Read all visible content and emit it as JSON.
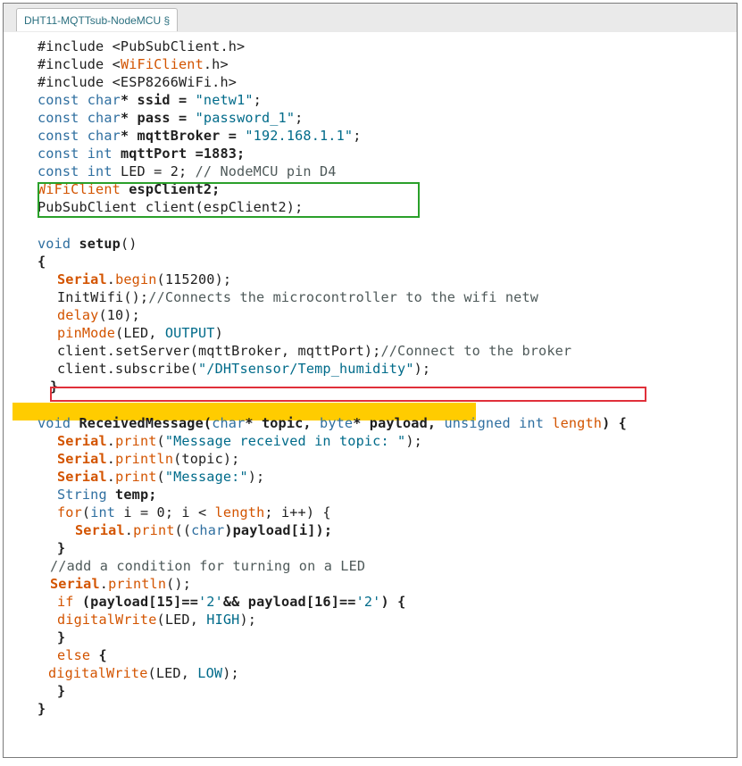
{
  "tab": {
    "label": "DHT11-MQTTsub-NodeMCU §"
  },
  "code": {
    "l1": [
      "#include <PubSubClient.h>"
    ],
    "l2": [
      "#include <",
      "WiFiClient",
      ".h>"
    ],
    "l3": [
      "#include <ESP8266WiFi.h>"
    ],
    "l4": [
      "const",
      " ",
      "char",
      "* ssid = ",
      "\"netw1\"",
      ";"
    ],
    "l5": [
      "const",
      " ",
      "char",
      "* pass = ",
      "\"password_1\"",
      ";"
    ],
    "l6": [
      "const",
      " ",
      "char",
      "* mqttBroker = ",
      "\"192.168.1.1\"",
      ";"
    ],
    "l7": [
      "const",
      " ",
      "int",
      " mqttPort =1883;"
    ],
    "l8": [
      "const",
      " ",
      "int",
      " LED = 2; ",
      "// NodeMCU pin D4"
    ],
    "l9": [
      "WiFiClient",
      " espClient2;"
    ],
    "l10": [
      "PubSubClient client(espClient2);"
    ],
    "l12": [
      "void",
      " ",
      "setup",
      "()"
    ],
    "l13": [
      "{"
    ],
    "l14": [
      "Serial",
      ".",
      "begin",
      "(115200);"
    ],
    "l15": [
      "InitWifi();",
      "//Connects the microcontroller to the wifi netw"
    ],
    "l16": [
      "delay",
      "(10);"
    ],
    "l17": [
      "pinMode",
      "(LED, ",
      "OUTPUT",
      ")"
    ],
    "l18": [
      "client.setServer(mqttBroker, mqttPort);",
      "//Connect to the broker"
    ],
    "l19": [
      "client.subscribe(",
      "\"/DHTsensor/Temp_humidity\"",
      ");"
    ],
    "l20": [
      "}"
    ],
    "l22": [
      "void",
      " ReceivedMessage(",
      "char",
      "* topic, ",
      "byte",
      "* payload, ",
      "unsigned",
      " ",
      "int",
      " ",
      "length",
      ") {"
    ],
    "l23": [
      "Serial",
      ".",
      "print",
      "(",
      "\"Message received in topic: \"",
      ");"
    ],
    "l24": [
      "Serial",
      ".",
      "println",
      "(topic);"
    ],
    "l25": [
      "Serial",
      ".",
      "print",
      "(",
      "\"Message:\"",
      ");"
    ],
    "l26": [
      "String",
      " temp;"
    ],
    "l27": [
      "for",
      "(",
      "int",
      " i = 0; i < ",
      "length",
      "; i++) {"
    ],
    "l28": [
      "Serial",
      ".",
      "print",
      "((",
      "char",
      ")payload[i]);"
    ],
    "l29": [
      "}"
    ],
    "l30": [
      "//add a condition for turning on a LED"
    ],
    "l31": [
      "Serial",
      ".",
      "println",
      "();"
    ],
    "l32": [
      "if",
      " (payload[15]==",
      "'2'",
      "&& payload[16]==",
      "'2'",
      ") {"
    ],
    "l33": [
      "digitalWrite",
      "(LED, ",
      "HIGH",
      ");"
    ],
    "l34": [
      "}"
    ],
    "l35": [
      "else",
      " {"
    ],
    "l36": [
      "digitalWrite",
      "(LED, ",
      "LOW",
      ");"
    ],
    "l37": [
      "}"
    ],
    "l38": [
      "}"
    ]
  },
  "colors": {
    "keyword": "#2f6fa0",
    "function": "#d35400",
    "string": "#006b8a",
    "comment": "#4f5a5a",
    "highlight": "#ffcc00",
    "green_box": "#2aa02a",
    "red_box": "#e0303a"
  }
}
